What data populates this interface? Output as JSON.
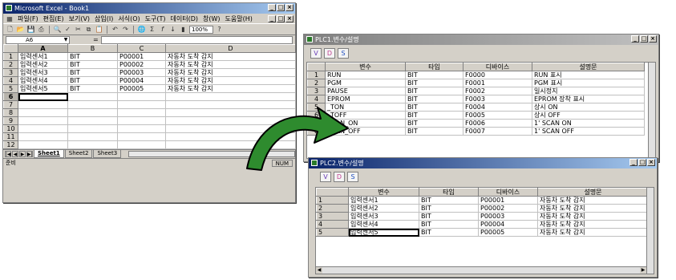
{
  "excel": {
    "title": "Microsoft Excel - Book1",
    "menus": [
      "파일(F)",
      "편집(E)",
      "보기(V)",
      "삽입(I)",
      "서식(O)",
      "도구(T)",
      "데이터(D)",
      "창(W)",
      "도움말(H)"
    ],
    "zoom": "100%",
    "name_box": "A6",
    "fx": "=",
    "columns": [
      "A",
      "B",
      "C",
      "D"
    ],
    "row_numbers": [
      "1",
      "2",
      "3",
      "4",
      "5",
      "6",
      "7",
      "8",
      "9",
      "10",
      "11",
      "12"
    ],
    "rows": [
      [
        "입력센서1",
        "BIT",
        "P00001",
        "자동차 도착 감지"
      ],
      [
        "입력센서2",
        "BIT",
        "P00002",
        "자동차 도착 감지"
      ],
      [
        "입력센서3",
        "BIT",
        "P00003",
        "자동차 도착 감지"
      ],
      [
        "입력센서4",
        "BIT",
        "P00004",
        "자동차 도착 감지"
      ],
      [
        "입력센서5",
        "BIT",
        "P00005",
        "자동차 도착 감지"
      ]
    ],
    "sheet_tabs": [
      "Sheet1",
      "Sheet2",
      "Sheet3"
    ],
    "status_left": "준비",
    "status_right": "NUM"
  },
  "plc1": {
    "title": "PLC1.변수/설명",
    "toolbar": [
      "V",
      "D",
      "S"
    ],
    "headers": [
      "변수",
      "타입",
      "디바이스",
      "설명문"
    ],
    "row_numbers": [
      "1",
      "2",
      "3",
      "4",
      "5",
      "6",
      "7",
      "8"
    ],
    "rows": [
      [
        "RUN",
        "BIT",
        "F0000",
        "RUN 표시"
      ],
      [
        "PGM",
        "BIT",
        "F0001",
        "PGM 표시"
      ],
      [
        "PAUSE",
        "BIT",
        "F0002",
        "일시정지"
      ],
      [
        "EPROM",
        "BIT",
        "F0003",
        "EPROM 장착 표시"
      ],
      [
        "_TON",
        "BIT",
        "F0004",
        "상시 ON"
      ],
      [
        "_TOFF",
        "BIT",
        "F0005",
        "상시 OFF"
      ],
      [
        "SCAN_ON",
        "BIT",
        "F0006",
        "1' SCAN ON"
      ],
      [
        "SCAN_OFF",
        "BIT",
        "F0007",
        "1' SCAN OFF"
      ]
    ]
  },
  "plc2": {
    "title": "PLC2.변수/설명",
    "toolbar": [
      "V",
      "D",
      "S"
    ],
    "headers": [
      "변수",
      "타입",
      "디바이스",
      "설명문"
    ],
    "row_numbers": [
      "1",
      "2",
      "3",
      "4",
      "5"
    ],
    "rows": [
      [
        "입력센서1",
        "BIT",
        "P00001",
        "자동차 도착 감지"
      ],
      [
        "입력센서2",
        "BIT",
        "P00002",
        "자동차 도착 감지"
      ],
      [
        "입력센서3",
        "BIT",
        "P00003",
        "자동차 도착 감지"
      ],
      [
        "입력센서4",
        "BIT",
        "P00004",
        "자동차 도착 감지"
      ],
      [
        "입력센서5",
        "BIT",
        "P00005",
        "자동차 도착 감지"
      ]
    ]
  },
  "colors": {
    "titlebar_start": "#0a246a",
    "titlebar_end": "#a6caf0",
    "arrow": "#2e8b2e"
  }
}
